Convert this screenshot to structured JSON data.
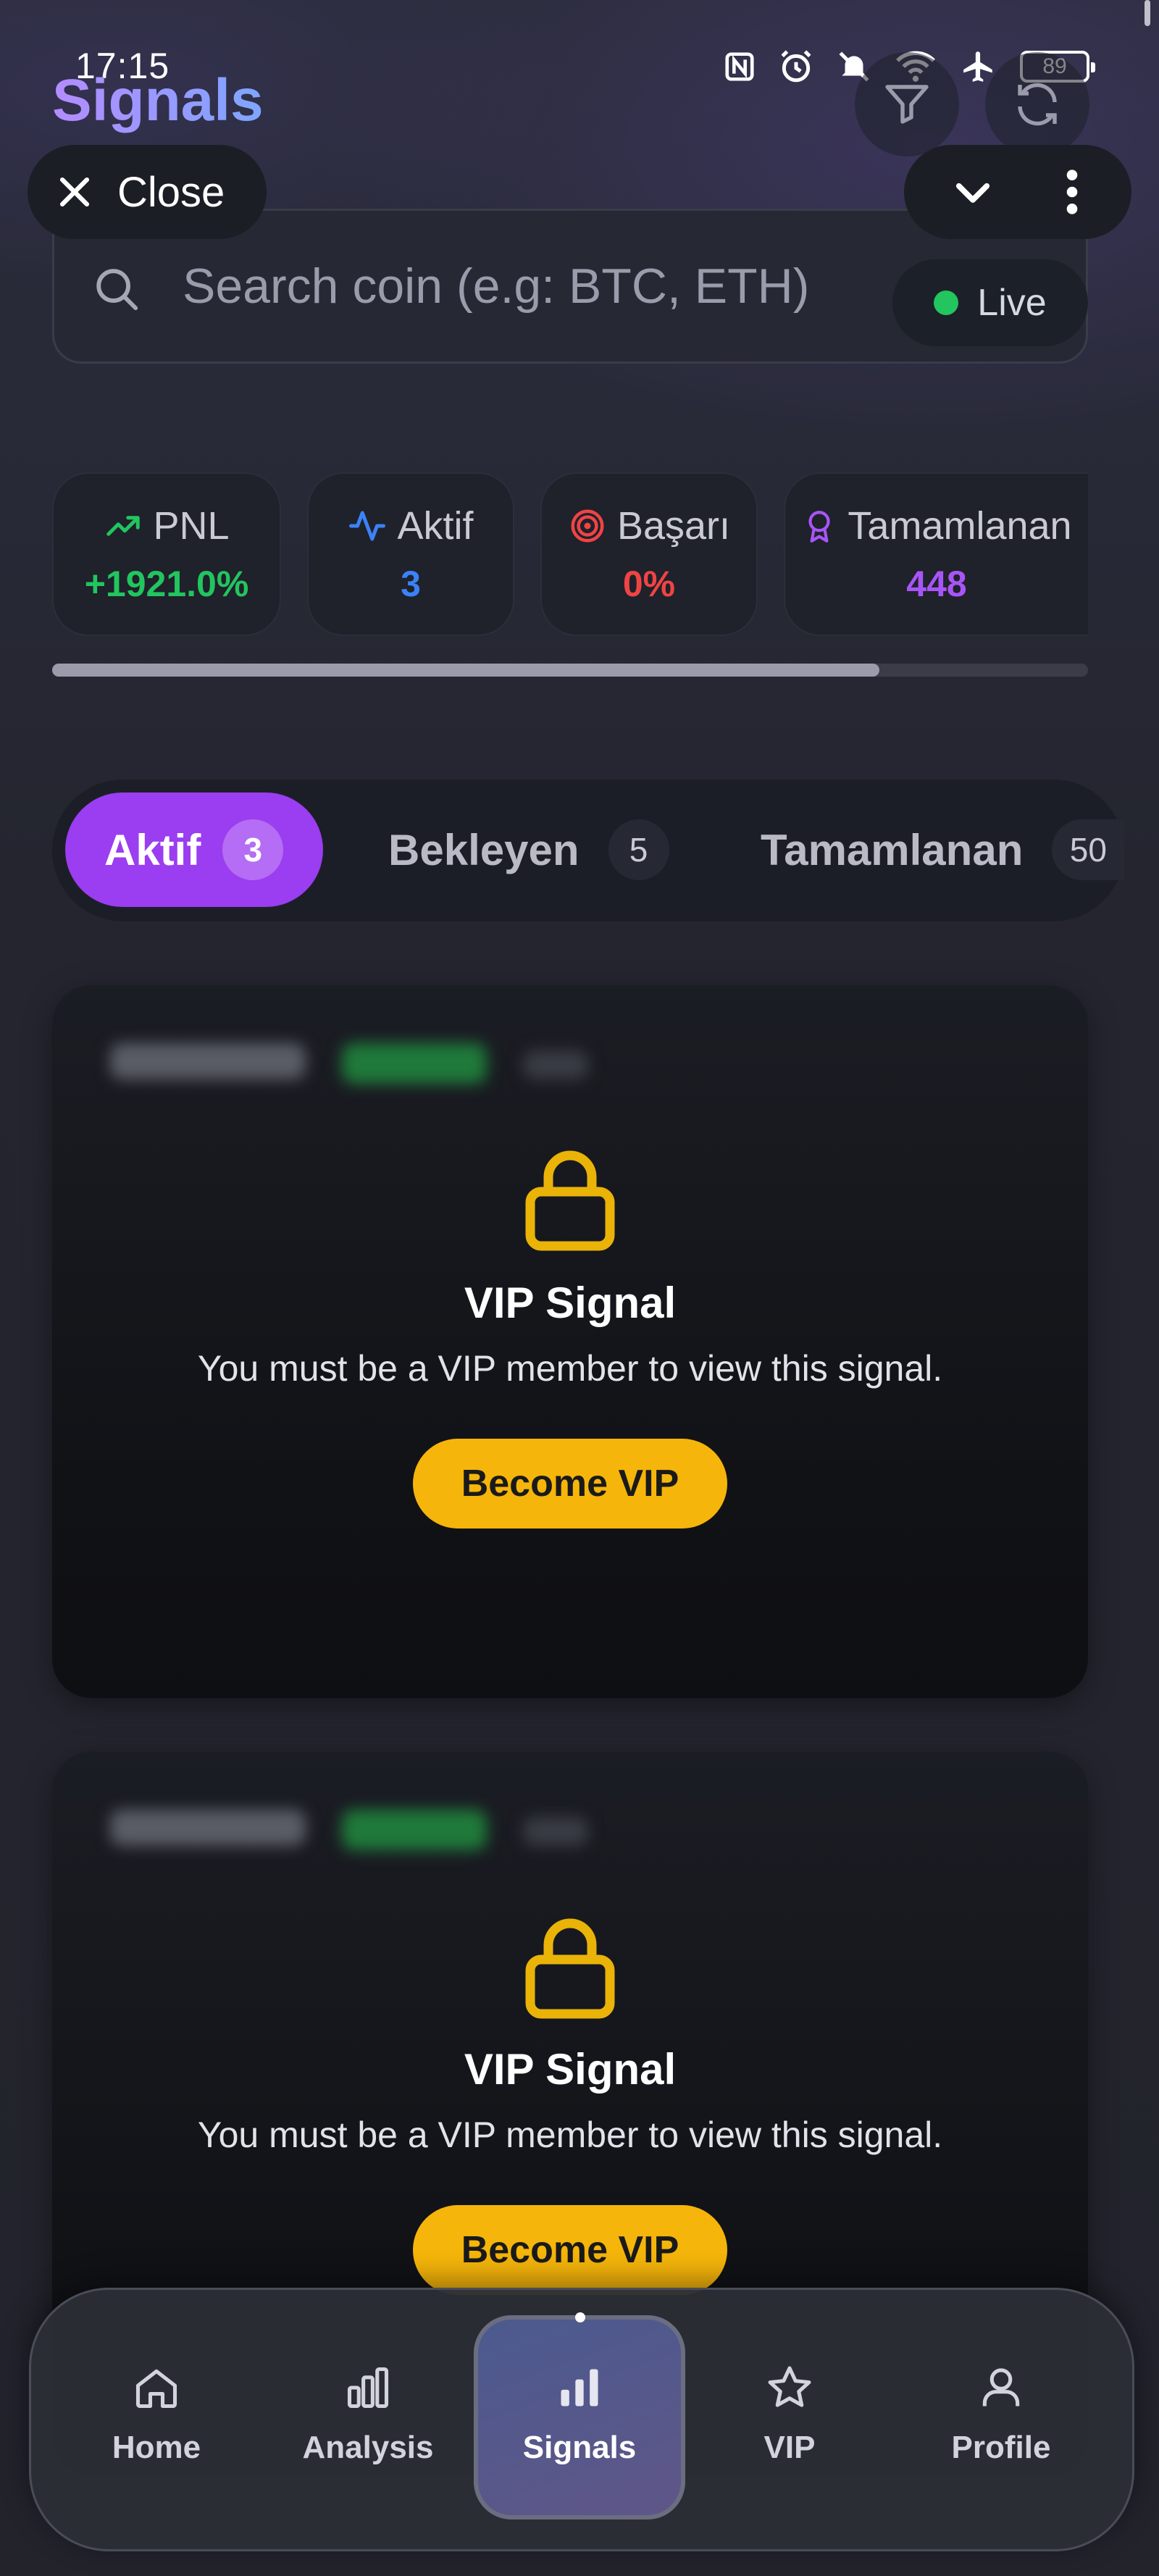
{
  "status_bar": {
    "time": "17:15",
    "battery": "89"
  },
  "header": {
    "title": "Signals",
    "close_label": "Close"
  },
  "search": {
    "placeholder": "Search coin (e.g: BTC, ETH)",
    "value": "",
    "live_label": "Live"
  },
  "stats": [
    {
      "label": "PNL",
      "value": "+1921.0%",
      "color": "#22c55e",
      "icon": "trending-up-icon"
    },
    {
      "label": "Aktif",
      "value": "3",
      "color": "#3b82f6",
      "icon": "activity-icon"
    },
    {
      "label": "Başarı",
      "value": "0%",
      "color": "#ef4444",
      "icon": "target-icon"
    },
    {
      "label": "Tamamlanan",
      "value": "448",
      "color": "#a855f7",
      "icon": "award-icon"
    }
  ],
  "tabs": [
    {
      "label": "Aktif",
      "count": "3",
      "active": true
    },
    {
      "label": "Bekleyen",
      "count": "5",
      "active": false
    },
    {
      "label": "Tamamlanan",
      "count": "50",
      "active": false
    }
  ],
  "signals": [
    {
      "title": "VIP Signal",
      "description": "You must be a VIP member to view this signal.",
      "button": "Become VIP"
    },
    {
      "title": "VIP Signal",
      "description": "You must be a VIP member to view this signal.",
      "button": "Become VIP"
    }
  ],
  "bottom_nav": [
    {
      "label": "Home",
      "icon": "home-icon"
    },
    {
      "label": "Analysis",
      "icon": "bar-chart-icon"
    },
    {
      "label": "Signals",
      "icon": "signal-bars-icon",
      "active": true
    },
    {
      "label": "VIP",
      "icon": "star-icon"
    },
    {
      "label": "Profile",
      "icon": "user-icon"
    }
  ],
  "colors": {
    "accent": "#9b3df0",
    "vip_button": "#f5b50a",
    "lock": "#eab308",
    "live": "#22c55e"
  }
}
